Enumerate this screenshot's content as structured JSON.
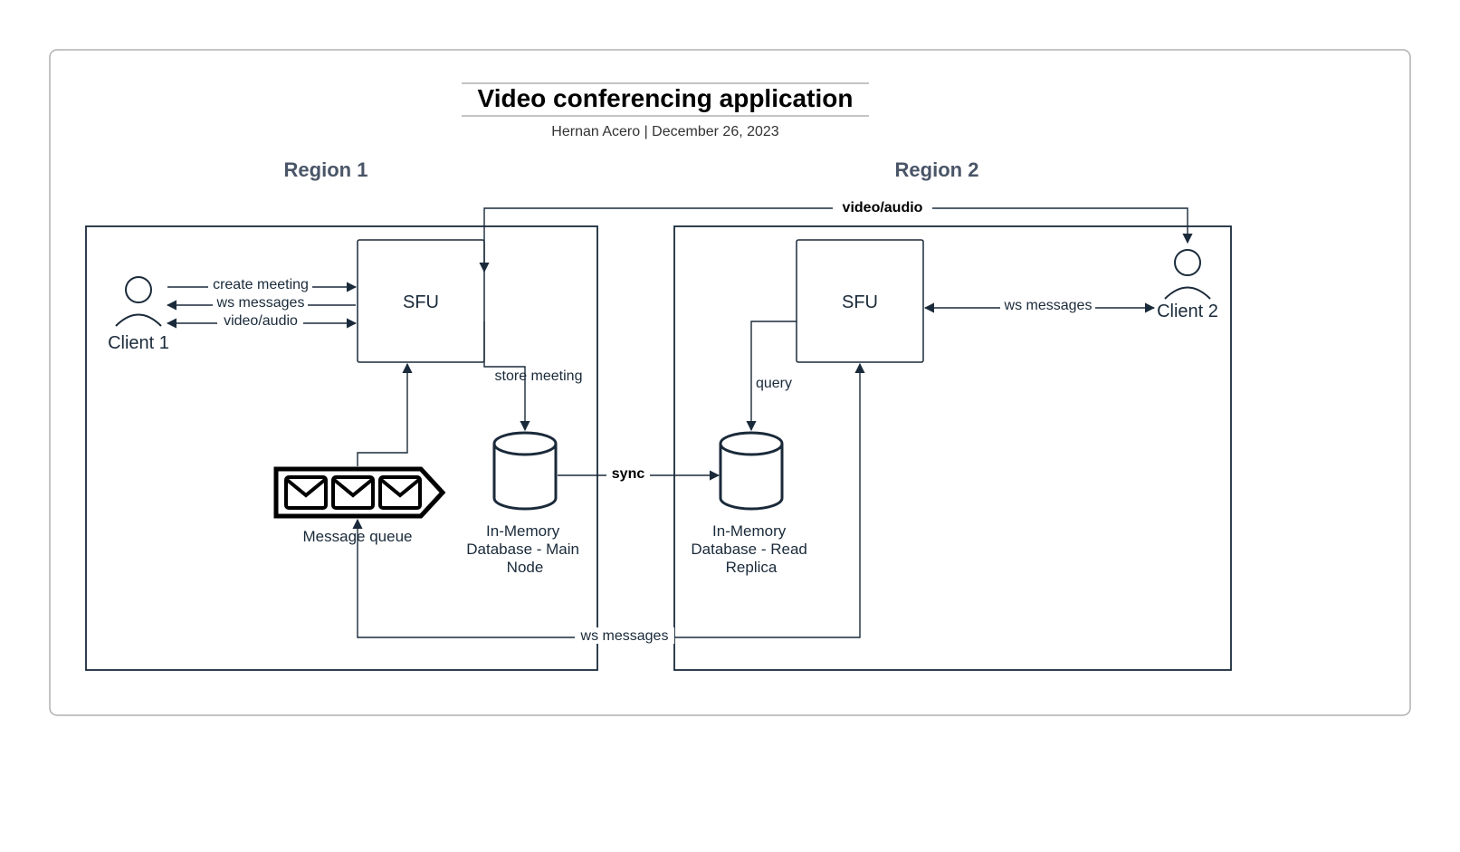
{
  "title": "Video conferencing application",
  "author": "Hernan Acero",
  "date": "December 26, 2023",
  "regions": {
    "r1": "Region 1",
    "r2": "Region 2"
  },
  "nodes": {
    "client1": "Client 1",
    "client2": "Client 2",
    "sfu1": "SFU",
    "sfu2": "SFU",
    "mq": "Message queue",
    "db1a": "In-Memory",
    "db1b": "Database - Main",
    "db1c": "Node",
    "db2a": "In-Memory",
    "db2b": "Database - Read",
    "db2c": "Replica"
  },
  "edges": {
    "create": "create meeting",
    "ws": "ws messages",
    "va": "video/audio",
    "store": "store meeting",
    "sync": "sync",
    "query": "query",
    "ws2": "ws messages",
    "ws_bus": "ws messages",
    "va_top": "video/audio"
  }
}
